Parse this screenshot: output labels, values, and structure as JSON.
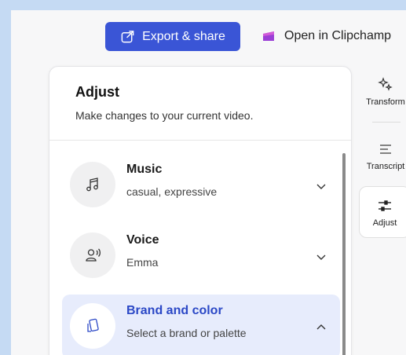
{
  "toolbar": {
    "export_label": "Export & share",
    "clipchamp_label": "Open in Clipchamp"
  },
  "panel": {
    "title": "Adjust",
    "subtitle": "Make changes to your current video.",
    "items": [
      {
        "title": "Music",
        "subtitle": "casual, expressive",
        "icon": "music-note-icon",
        "expanded": false
      },
      {
        "title": "Voice",
        "subtitle": "Emma",
        "icon": "voice-person-icon",
        "expanded": false
      },
      {
        "title": "Brand and color",
        "subtitle": "Select a brand or palette",
        "icon": "brand-palette-icon",
        "expanded": true
      }
    ]
  },
  "rail": {
    "items": [
      {
        "label": "Transform",
        "icon": "sparkle-transform-icon"
      },
      {
        "label": "Transcript",
        "icon": "transcript-lines-icon"
      },
      {
        "label": "Adjust",
        "icon": "sliders-icon",
        "selected": true
      }
    ]
  },
  "colors": {
    "accent": "#3a55d6",
    "accent_text": "#2b48c6",
    "active_item_bg": "#e7ecfc",
    "background": "#c5daf3"
  }
}
